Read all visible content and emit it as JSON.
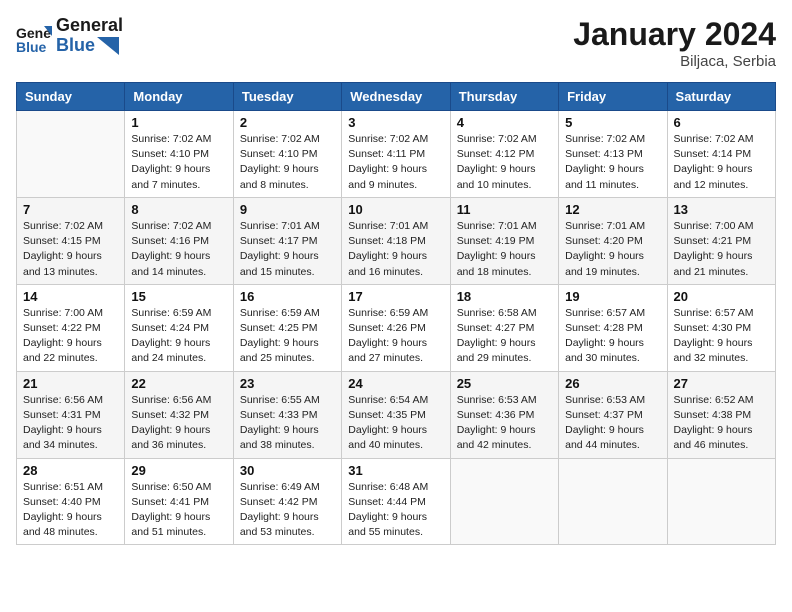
{
  "header": {
    "logo_line1": "General",
    "logo_line2": "Blue",
    "month_title": "January 2024",
    "location": "Biljaca, Serbia"
  },
  "weekdays": [
    "Sunday",
    "Monday",
    "Tuesday",
    "Wednesday",
    "Thursday",
    "Friday",
    "Saturday"
  ],
  "weeks": [
    [
      {
        "day": "",
        "info": ""
      },
      {
        "day": "1",
        "info": "Sunrise: 7:02 AM\nSunset: 4:10 PM\nDaylight: 9 hours\nand 7 minutes."
      },
      {
        "day": "2",
        "info": "Sunrise: 7:02 AM\nSunset: 4:10 PM\nDaylight: 9 hours\nand 8 minutes."
      },
      {
        "day": "3",
        "info": "Sunrise: 7:02 AM\nSunset: 4:11 PM\nDaylight: 9 hours\nand 9 minutes."
      },
      {
        "day": "4",
        "info": "Sunrise: 7:02 AM\nSunset: 4:12 PM\nDaylight: 9 hours\nand 10 minutes."
      },
      {
        "day": "5",
        "info": "Sunrise: 7:02 AM\nSunset: 4:13 PM\nDaylight: 9 hours\nand 11 minutes."
      },
      {
        "day": "6",
        "info": "Sunrise: 7:02 AM\nSunset: 4:14 PM\nDaylight: 9 hours\nand 12 minutes."
      }
    ],
    [
      {
        "day": "7",
        "info": "Sunrise: 7:02 AM\nSunset: 4:15 PM\nDaylight: 9 hours\nand 13 minutes."
      },
      {
        "day": "8",
        "info": "Sunrise: 7:02 AM\nSunset: 4:16 PM\nDaylight: 9 hours\nand 14 minutes."
      },
      {
        "day": "9",
        "info": "Sunrise: 7:01 AM\nSunset: 4:17 PM\nDaylight: 9 hours\nand 15 minutes."
      },
      {
        "day": "10",
        "info": "Sunrise: 7:01 AM\nSunset: 4:18 PM\nDaylight: 9 hours\nand 16 minutes."
      },
      {
        "day": "11",
        "info": "Sunrise: 7:01 AM\nSunset: 4:19 PM\nDaylight: 9 hours\nand 18 minutes."
      },
      {
        "day": "12",
        "info": "Sunrise: 7:01 AM\nSunset: 4:20 PM\nDaylight: 9 hours\nand 19 minutes."
      },
      {
        "day": "13",
        "info": "Sunrise: 7:00 AM\nSunset: 4:21 PM\nDaylight: 9 hours\nand 21 minutes."
      }
    ],
    [
      {
        "day": "14",
        "info": "Sunrise: 7:00 AM\nSunset: 4:22 PM\nDaylight: 9 hours\nand 22 minutes."
      },
      {
        "day": "15",
        "info": "Sunrise: 6:59 AM\nSunset: 4:24 PM\nDaylight: 9 hours\nand 24 minutes."
      },
      {
        "day": "16",
        "info": "Sunrise: 6:59 AM\nSunset: 4:25 PM\nDaylight: 9 hours\nand 25 minutes."
      },
      {
        "day": "17",
        "info": "Sunrise: 6:59 AM\nSunset: 4:26 PM\nDaylight: 9 hours\nand 27 minutes."
      },
      {
        "day": "18",
        "info": "Sunrise: 6:58 AM\nSunset: 4:27 PM\nDaylight: 9 hours\nand 29 minutes."
      },
      {
        "day": "19",
        "info": "Sunrise: 6:57 AM\nSunset: 4:28 PM\nDaylight: 9 hours\nand 30 minutes."
      },
      {
        "day": "20",
        "info": "Sunrise: 6:57 AM\nSunset: 4:30 PM\nDaylight: 9 hours\nand 32 minutes."
      }
    ],
    [
      {
        "day": "21",
        "info": "Sunrise: 6:56 AM\nSunset: 4:31 PM\nDaylight: 9 hours\nand 34 minutes."
      },
      {
        "day": "22",
        "info": "Sunrise: 6:56 AM\nSunset: 4:32 PM\nDaylight: 9 hours\nand 36 minutes."
      },
      {
        "day": "23",
        "info": "Sunrise: 6:55 AM\nSunset: 4:33 PM\nDaylight: 9 hours\nand 38 minutes."
      },
      {
        "day": "24",
        "info": "Sunrise: 6:54 AM\nSunset: 4:35 PM\nDaylight: 9 hours\nand 40 minutes."
      },
      {
        "day": "25",
        "info": "Sunrise: 6:53 AM\nSunset: 4:36 PM\nDaylight: 9 hours\nand 42 minutes."
      },
      {
        "day": "26",
        "info": "Sunrise: 6:53 AM\nSunset: 4:37 PM\nDaylight: 9 hours\nand 44 minutes."
      },
      {
        "day": "27",
        "info": "Sunrise: 6:52 AM\nSunset: 4:38 PM\nDaylight: 9 hours\nand 46 minutes."
      }
    ],
    [
      {
        "day": "28",
        "info": "Sunrise: 6:51 AM\nSunset: 4:40 PM\nDaylight: 9 hours\nand 48 minutes."
      },
      {
        "day": "29",
        "info": "Sunrise: 6:50 AM\nSunset: 4:41 PM\nDaylight: 9 hours\nand 51 minutes."
      },
      {
        "day": "30",
        "info": "Sunrise: 6:49 AM\nSunset: 4:42 PM\nDaylight: 9 hours\nand 53 minutes."
      },
      {
        "day": "31",
        "info": "Sunrise: 6:48 AM\nSunset: 4:44 PM\nDaylight: 9 hours\nand 55 minutes."
      },
      {
        "day": "",
        "info": ""
      },
      {
        "day": "",
        "info": ""
      },
      {
        "day": "",
        "info": ""
      }
    ]
  ]
}
